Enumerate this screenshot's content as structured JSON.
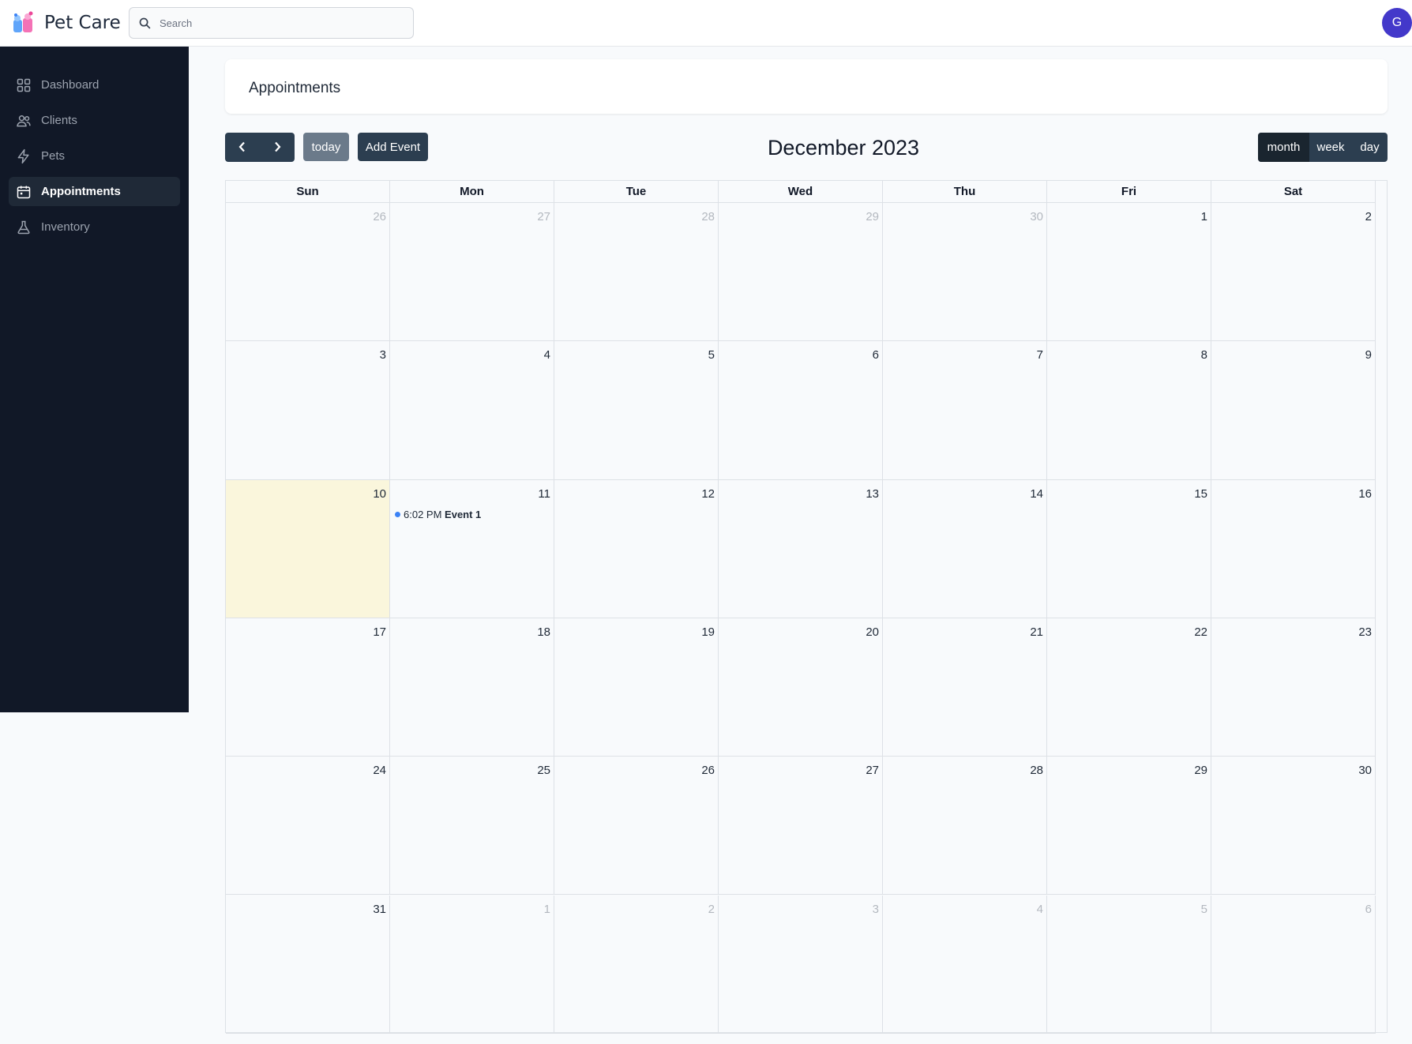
{
  "app": {
    "title": "Pet Care"
  },
  "search": {
    "placeholder": "Search"
  },
  "user": {
    "avatar_initial": "G",
    "avatar_color": "#4338ca"
  },
  "sidebar": {
    "items": [
      {
        "label": "Dashboard",
        "icon": "grid-icon",
        "active": false
      },
      {
        "label": "Clients",
        "icon": "users-icon",
        "active": false
      },
      {
        "label": "Pets",
        "icon": "bolt-icon",
        "active": false
      },
      {
        "label": "Appointments",
        "icon": "calendar-icon",
        "active": true
      },
      {
        "label": "Inventory",
        "icon": "flask-icon",
        "active": false
      }
    ]
  },
  "page": {
    "title": "Appointments"
  },
  "toolbar": {
    "today_label": "today",
    "add_event_label": "Add Event",
    "title": "December 2023",
    "views": [
      "month",
      "week",
      "day"
    ],
    "active_view": "month"
  },
  "calendar": {
    "weekdays": [
      "Sun",
      "Mon",
      "Tue",
      "Wed",
      "Thu",
      "Fri",
      "Sat"
    ],
    "weeks": [
      [
        {
          "d": "26",
          "o": true
        },
        {
          "d": "27",
          "o": true
        },
        {
          "d": "28",
          "o": true
        },
        {
          "d": "29",
          "o": true
        },
        {
          "d": "30",
          "o": true
        },
        {
          "d": "1"
        },
        {
          "d": "2"
        }
      ],
      [
        {
          "d": "3"
        },
        {
          "d": "4"
        },
        {
          "d": "5"
        },
        {
          "d": "6"
        },
        {
          "d": "7"
        },
        {
          "d": "8"
        },
        {
          "d": "9"
        }
      ],
      [
        {
          "d": "10",
          "today": true
        },
        {
          "d": "11",
          "event": {
            "time": "6:02 PM",
            "title": "Event 1"
          }
        },
        {
          "d": "12"
        },
        {
          "d": "13"
        },
        {
          "d": "14"
        },
        {
          "d": "15"
        },
        {
          "d": "16"
        }
      ],
      [
        {
          "d": "17"
        },
        {
          "d": "18"
        },
        {
          "d": "19"
        },
        {
          "d": "20"
        },
        {
          "d": "21"
        },
        {
          "d": "22"
        },
        {
          "d": "23"
        }
      ],
      [
        {
          "d": "24"
        },
        {
          "d": "25"
        },
        {
          "d": "26"
        },
        {
          "d": "27"
        },
        {
          "d": "28"
        },
        {
          "d": "29"
        },
        {
          "d": "30"
        }
      ],
      [
        {
          "d": "31"
        },
        {
          "d": "1",
          "o": true
        },
        {
          "d": "2",
          "o": true
        },
        {
          "d": "3",
          "o": true
        },
        {
          "d": "4",
          "o": true
        },
        {
          "d": "5",
          "o": true
        },
        {
          "d": "6",
          "o": true
        }
      ]
    ]
  },
  "colors": {
    "sidebar_bg": "#111827",
    "button_dark": "#2c3e50",
    "today_bg": "#faf6dc",
    "event_dot": "#3b82f6"
  }
}
